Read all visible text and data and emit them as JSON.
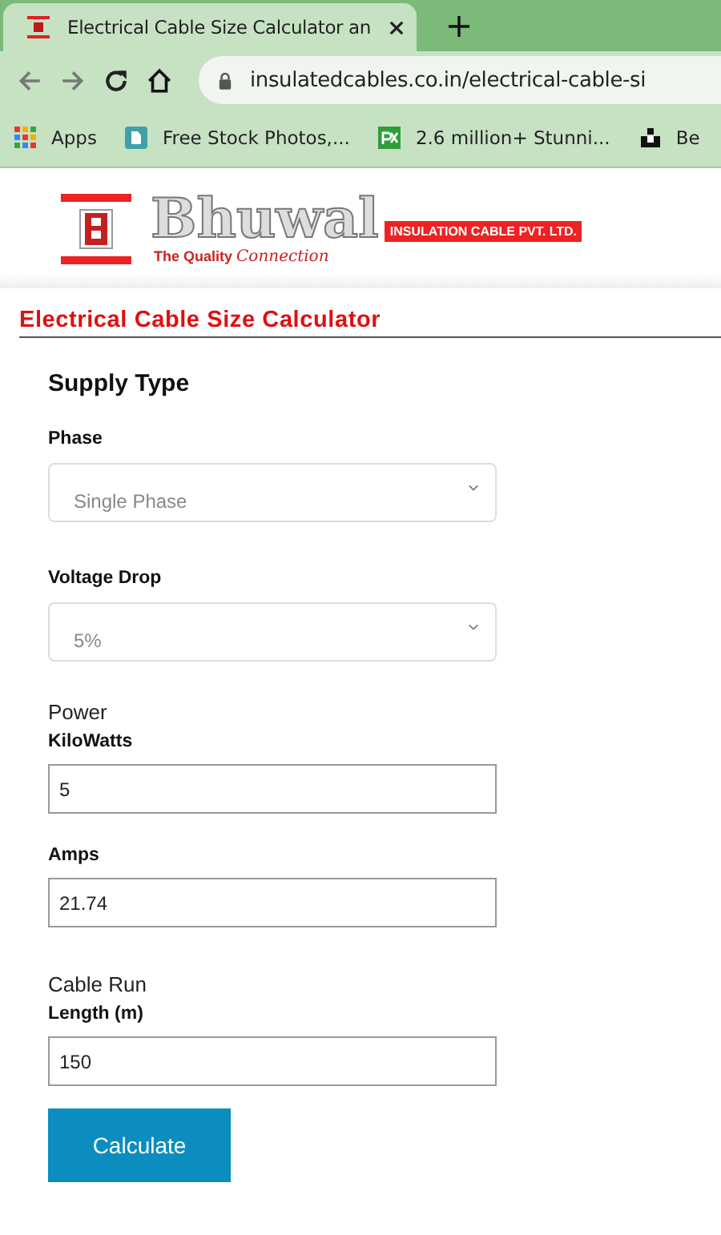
{
  "browser": {
    "tab": {
      "title": "Electrical Cable Size Calculator an"
    },
    "url": "insulatedcables.co.in/electrical-cable-si",
    "bookmarks": [
      {
        "label": "Apps",
        "kind": "apps"
      },
      {
        "label": "Free Stock Photos,...",
        "kind": "stock"
      },
      {
        "label": "2.6 million+ Stunni...",
        "kind": "px"
      },
      {
        "label": "Be",
        "kind": "blocks"
      }
    ]
  },
  "logo": {
    "name": "Bhuwal",
    "company": "INSULATION CABLE PVT. LTD.",
    "tagline": "The Quality",
    "tagline_script": "Connection"
  },
  "page_title": "Electrical Cable Size Calculator",
  "form": {
    "heading": "Supply Type",
    "items": [
      {
        "kind": "select",
        "label": "Phase",
        "value": "Single Phase"
      },
      {
        "kind": "select",
        "label": "Voltage Drop",
        "value": "5%"
      },
      {
        "kind": "group",
        "label": "Power"
      },
      {
        "kind": "input",
        "label": "KiloWatts",
        "value": "5"
      },
      {
        "kind": "input",
        "label": "Amps",
        "value": "21.74"
      },
      {
        "kind": "group",
        "label": "Cable Run"
      },
      {
        "kind": "input",
        "label": "Length (m)",
        "value": "150"
      }
    ],
    "button": "Calculate"
  }
}
